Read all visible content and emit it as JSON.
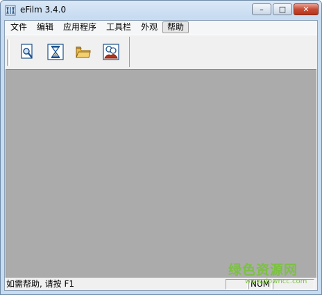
{
  "window": {
    "title": "eFilm 3.4.0",
    "controls": {
      "minimize": "–",
      "maximize": "□",
      "close": "✕"
    }
  },
  "menubar": {
    "items": [
      {
        "label": "文件"
      },
      {
        "label": "编辑"
      },
      {
        "label": "应用程序"
      },
      {
        "label": "工具栏"
      },
      {
        "label": "外观"
      },
      {
        "label": "帮助"
      }
    ]
  },
  "toolbar": {
    "buttons": [
      {
        "icon": "search-document-icon"
      },
      {
        "icon": "hourglass-icon"
      },
      {
        "icon": "open-folder-icon"
      },
      {
        "icon": "users-icon"
      }
    ]
  },
  "statusbar": {
    "help_text": "如需帮助, 请按 F1",
    "num_indicator": "NUM"
  },
  "watermark": {
    "main": "绿色资源网",
    "sub": "www.downcc.com"
  },
  "colors": {
    "workspace": "#ababab",
    "titlebar": "#c7dbf1",
    "close_button": "#c74a34",
    "watermark": "#7cc142"
  }
}
